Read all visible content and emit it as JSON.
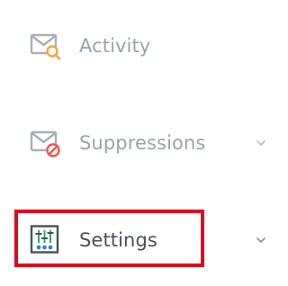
{
  "nav": {
    "items": [
      {
        "label": "Activity",
        "icon": "envelope-search-icon",
        "has_chevron": false
      },
      {
        "label": "Suppressions",
        "icon": "envelope-blocked-icon",
        "has_chevron": true
      },
      {
        "label": "Settings",
        "icon": "settings-sliders-icon",
        "has_chevron": true,
        "highlighted": true
      }
    ]
  },
  "colors": {
    "muted_text": "#9aa3ab",
    "active_text": "#4a5159",
    "icon_gray": "#a7b0b8",
    "accent_orange": "#f3a73b",
    "accent_red": "#f0554a",
    "highlight_red": "#e8001c",
    "slider_green": "#3aa65a",
    "slider_blue": "#2a7fd4"
  }
}
